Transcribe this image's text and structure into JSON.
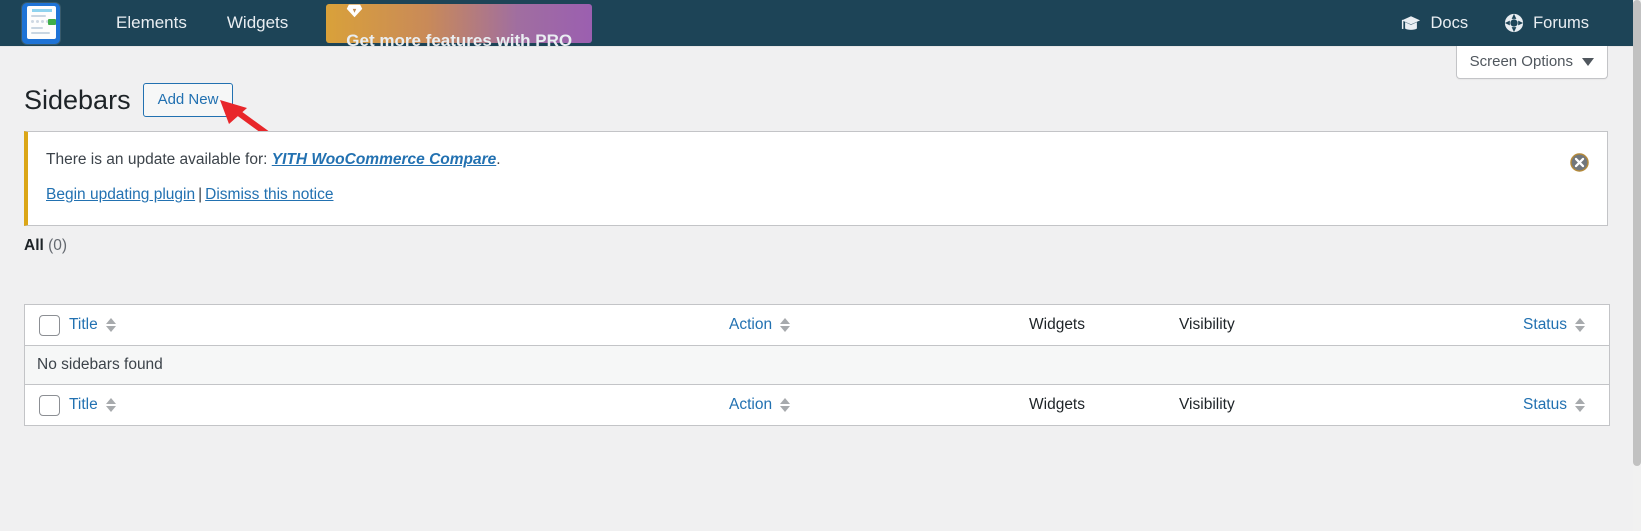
{
  "topbar": {
    "logo_name": "sidebar-manager-logo",
    "nav": [
      {
        "label": "Elements",
        "name": "nav-elements"
      },
      {
        "label": "Widgets",
        "name": "nav-widgets"
      }
    ],
    "pro_button": {
      "label": "Get more features with PRO",
      "icon": "gem-icon"
    },
    "right_links": [
      {
        "label": "Docs",
        "icon": "graduation-cap-icon",
        "name": "nav-docs"
      },
      {
        "label": "Forums",
        "icon": "life-ring-icon",
        "name": "nav-forums"
      }
    ],
    "colors": {
      "background": "#1d4457",
      "text": "#e9eef2",
      "pro_start": "#d9a13a",
      "pro_end": "#9b5fb0"
    }
  },
  "screen_options": {
    "label": "Screen Options",
    "icon": "caret-down-icon"
  },
  "heading": {
    "title": "Sidebars",
    "add_new_label": "Add New"
  },
  "notice": {
    "message_prefix": "There is an update available for: ",
    "plugin_name": "YITH WooCommerce Compare",
    "message_suffix": ".",
    "begin_updating_label": "Begin updating plugin",
    "separator": "|",
    "dismiss_label": "Dismiss this notice",
    "close_icon": "close-circle-icon",
    "accent_color": "#dba617"
  },
  "filters": {
    "all_label": "All",
    "all_count": "(0)"
  },
  "table": {
    "columns": [
      {
        "key": "cb",
        "label": "",
        "sortable": false,
        "link": false
      },
      {
        "key": "title",
        "label": "Title",
        "sortable": true,
        "link": true
      },
      {
        "key": "action",
        "label": "Action",
        "sortable": true,
        "link": true
      },
      {
        "key": "widgets",
        "label": "Widgets",
        "sortable": false,
        "link": false
      },
      {
        "key": "visibility",
        "label": "Visibility",
        "sortable": false,
        "link": false
      },
      {
        "key": "status",
        "label": "Status",
        "sortable": true,
        "link": true
      }
    ],
    "headers": {
      "title": "Title",
      "action": "Action",
      "widgets": "Widgets",
      "visibility": "Visibility",
      "status": "Status"
    },
    "rows": [],
    "empty_message": "No sidebars found",
    "select_all_name": "select-all-checkbox"
  },
  "annotation": {
    "type": "red-arrow",
    "points_to": "add-new-button",
    "color": "#e8262a"
  }
}
